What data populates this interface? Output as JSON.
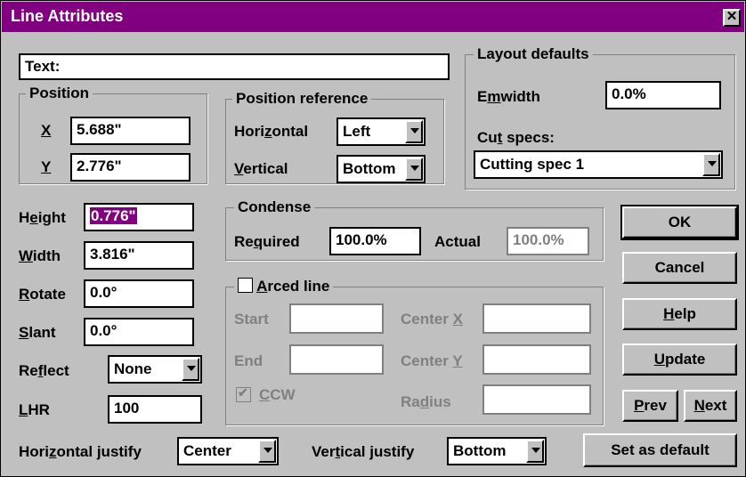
{
  "window": {
    "title": "Line Attributes",
    "close": "✕"
  },
  "text_field": {
    "value": "Text:"
  },
  "position": {
    "group": "Position",
    "x_label": "X",
    "x_value": "5.688\"",
    "y_label": "Y",
    "y_value": "2.776\""
  },
  "position_reference": {
    "group": "Position reference",
    "horizontal_label_pre": "Hori",
    "horizontal_label_u": "z",
    "horizontal_label_post": "ontal",
    "horizontal_value": "Left",
    "vertical_label_u": "V",
    "vertical_label_post": "ertical",
    "vertical_value": "Bottom"
  },
  "layout_defaults": {
    "group": "Layout defaults",
    "emwidth_label_pre": "E",
    "emwidth_label_u": "m",
    "emwidth_label_post": "width",
    "emwidth_value": "0.0%",
    "cutspecs_label_pre": "Cu",
    "cutspecs_label_u": "t",
    "cutspecs_label_post": " specs:",
    "cutspecs_value": "Cutting spec 1"
  },
  "attributes": {
    "height_pre": "H",
    "height_u": "e",
    "height_post": "ight",
    "height_value": "0.776\"",
    "width_u": "W",
    "width_post": "idth",
    "width_value": "3.816\"",
    "rotate_u": "R",
    "rotate_post": "otate",
    "rotate_value": "0.0°",
    "slant_u": "S",
    "slant_post": "lant",
    "slant_value": "0.0°",
    "reflect_pre": "Re",
    "reflect_u": "f",
    "reflect_post": "lect",
    "reflect_value": "None",
    "lhr_u": "L",
    "lhr_post": "HR",
    "lhr_value": "100"
  },
  "condense": {
    "group": "Condense",
    "required_pre": "Re",
    "required_u": "q",
    "required_post": "uired",
    "required_value": "100.0%",
    "actual_label": "Actual",
    "actual_value": "100.0%"
  },
  "arced": {
    "label_u": "A",
    "label_post": "rced line",
    "start_label": "Start",
    "end_label": "End",
    "centerx_pre": "Center ",
    "centerx_u": "X",
    "centery_pre": "Center ",
    "centery_u": "Y",
    "ccw_u": "C",
    "ccw_post": "CW",
    "radius_pre": "Ra",
    "radius_u": "d",
    "radius_post": "ius"
  },
  "justify": {
    "horizontal_pre": "Hori",
    "horizontal_u": "z",
    "horizontal_post": "ontal justify",
    "horizontal_value": "Center",
    "vertical_pre": "Ver",
    "vertical_u": "t",
    "vertical_post": "ical justify",
    "vertical_value": "Bottom"
  },
  "buttons": {
    "ok": "OK",
    "cancel": "Cancel",
    "help_u": "H",
    "help_post": "elp",
    "update_u": "U",
    "update_post": "pdate",
    "prev_u": "P",
    "prev_post": "rev",
    "next_u": "N",
    "next_post": "ext",
    "set_default": "Set as default"
  },
  "colors": {
    "titlebar": "#800080",
    "face": "#c0c0c0",
    "selection": "#800080"
  }
}
